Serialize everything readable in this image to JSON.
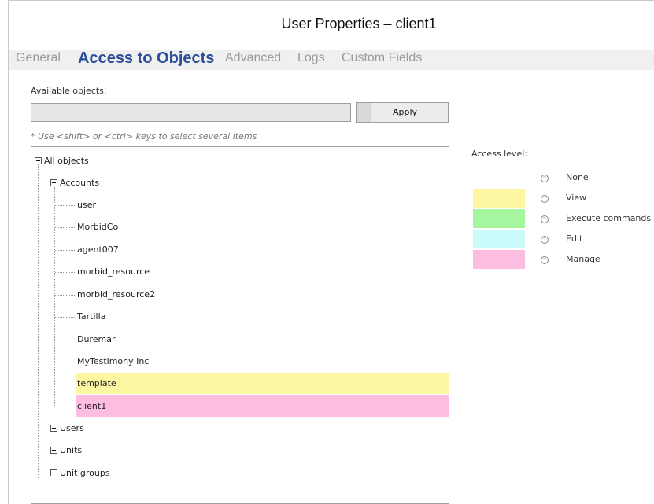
{
  "window": {
    "title": "User Properties – client1"
  },
  "tabs": [
    {
      "label": "General",
      "active": false
    },
    {
      "label": "Access to Objects",
      "active": true
    },
    {
      "label": "Advanced",
      "active": false
    },
    {
      "label": "Logs",
      "active": false
    },
    {
      "label": "Custom Fields",
      "active": false
    }
  ],
  "objects": {
    "label": "Available objects:",
    "field_value": "",
    "apply_label": "Apply",
    "hint": "* Use <shift> or <ctrl> keys to select several items"
  },
  "tree": {
    "root": "All objects",
    "accounts_label": "Accounts",
    "accounts": [
      {
        "label": "user",
        "access": "none"
      },
      {
        "label": "MorbidCo",
        "access": "none"
      },
      {
        "label": "agent007",
        "access": "none"
      },
      {
        "label": "morbid_resource",
        "access": "none"
      },
      {
        "label": "morbid_resource2",
        "access": "none"
      },
      {
        "label": "Tartilla",
        "access": "none"
      },
      {
        "label": "Duremar",
        "access": "none"
      },
      {
        "label": "MyTestimony Inc",
        "access": "none"
      },
      {
        "label": "template",
        "access": "view"
      },
      {
        "label": "client1",
        "access": "manage"
      }
    ],
    "groups": [
      "Users",
      "Units",
      "Unit groups"
    ]
  },
  "access": {
    "title": "Access level:",
    "levels": [
      {
        "label": "None",
        "color": ""
      },
      {
        "label": "View",
        "color": "#fdf6a3"
      },
      {
        "label": "Execute commands",
        "color": "#a6f59f"
      },
      {
        "label": "Edit",
        "color": "#cbfafa"
      },
      {
        "label": "Manage",
        "color": "#fcbde0"
      }
    ]
  },
  "colors": {
    "view_highlight": "#fdf6a3",
    "manage_highlight": "#fcbde0",
    "active_tab": "#2c4e9a"
  }
}
